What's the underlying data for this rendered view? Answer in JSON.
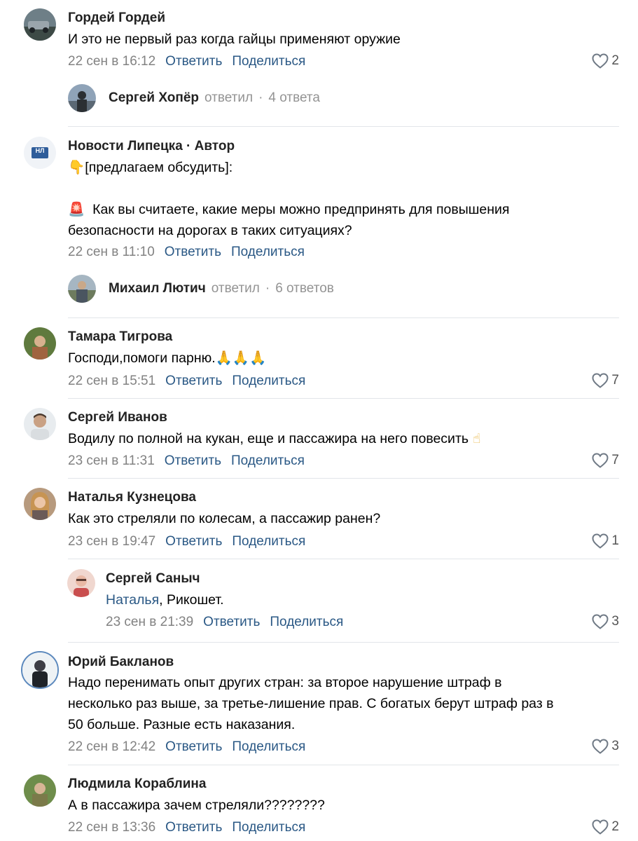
{
  "comments": [
    {
      "author": "Гордей Гордей",
      "text": "И это не первый раз когда гайцы применяют оружие",
      "time": "22 сен в 16:12",
      "reply_label": "Ответить",
      "share_label": "Поделиться",
      "likes": "2",
      "thread": {
        "name": "Сергей Хопёр",
        "verb": "ответил",
        "count": "4 ответа"
      }
    },
    {
      "author": "Новости Липецка · Автор",
      "avatar_text": "НЛ",
      "text_line1_emoji": "👇",
      "text_line1": "[предлагаем обсудить]:",
      "text_line2_emoji": "🚨",
      "text_line2": "Как вы считаете, какие меры можно предпринять для повышения",
      "text_line3": "безопасности на дорогах в таких ситуациях?",
      "time": "22 сен в 11:10",
      "reply_label": "Ответить",
      "share_label": "Поделиться",
      "thread": {
        "name": "Михаил Лютич",
        "verb": "ответил",
        "count": "6 ответов"
      }
    },
    {
      "author": "Тамара Тигрова",
      "text": "Господи,помоги парню.",
      "text_emoji": "🙏🙏🙏",
      "time": "22 сен в 15:51",
      "reply_label": "Ответить",
      "share_label": "Поделиться",
      "likes": "7"
    },
    {
      "author": "Сергей Иванов",
      "text": "Водилу по полной на кукан, еще и пассажира на него повесить",
      "text_emoji": "☝",
      "time": "23 сен в 11:31",
      "reply_label": "Ответить",
      "share_label": "Поделиться",
      "likes": "7"
    },
    {
      "author": "Наталья Кузнецова",
      "text": "Как это стреляли по колесам, а пассажир ранен?",
      "time": "23 сен в 19:47",
      "reply_label": "Ответить",
      "share_label": "Поделиться",
      "likes": "1"
    },
    {
      "author": "Сергей Саныч",
      "reply_to": "Наталья",
      "text": ", Рикошет.",
      "time": "23 сен в 21:39",
      "reply_label": "Ответить",
      "share_label": "Поделиться",
      "likes": "3"
    },
    {
      "author": "Юрий Бакланов",
      "text_line1": "Надо перенимать опыт других стран: за второе нарушение штраф в",
      "text_line2": "несколько раз выше, за третье-лишение прав. С богатых берут штраф раз в",
      "text_line3": "50 больше. Разные есть наказания.",
      "time": "22 сен в 12:42",
      "reply_label": "Ответить",
      "share_label": "Поделиться",
      "likes": "3"
    },
    {
      "author": "Людмила Кораблина",
      "text": "А в пассажира зачем стреляли????????",
      "time": "22 сен в 13:36",
      "reply_label": "Ответить",
      "share_label": "Поделиться",
      "likes": "2"
    }
  ],
  "colors": {
    "link": "#2a5885",
    "meta": "#828282",
    "divider": "#e2e5e9"
  }
}
